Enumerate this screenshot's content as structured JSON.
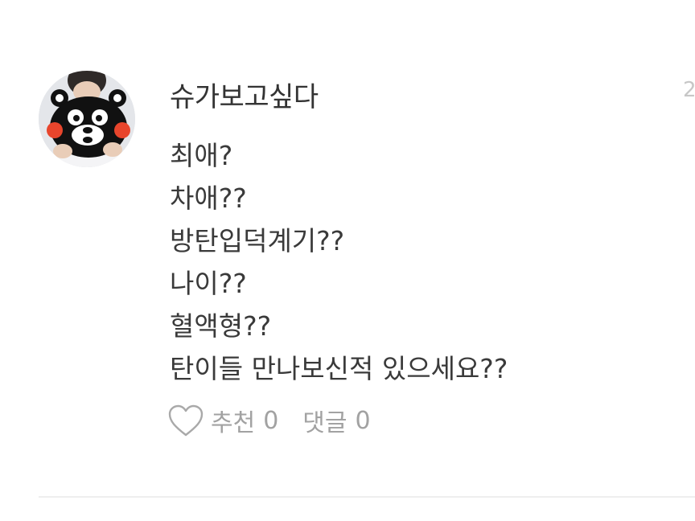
{
  "comment": {
    "username": "슈가보고싶다",
    "timestamp_partial": "2",
    "lines": [
      "최애?",
      "차애??",
      "방탄입덕계기??",
      "나이??",
      "혈액형??",
      "탄이들 만나보신적 있으세요??"
    ],
    "actions": {
      "like_label": "추천",
      "like_count": "0",
      "reply_label": "댓글",
      "reply_count": "0",
      "like_icon": "heart-outline-icon"
    }
  },
  "colors": {
    "text_primary": "#333333",
    "text_secondary": "#a2a2a2",
    "divider": "#eeeeee",
    "mascot_red": "#e8452c"
  }
}
